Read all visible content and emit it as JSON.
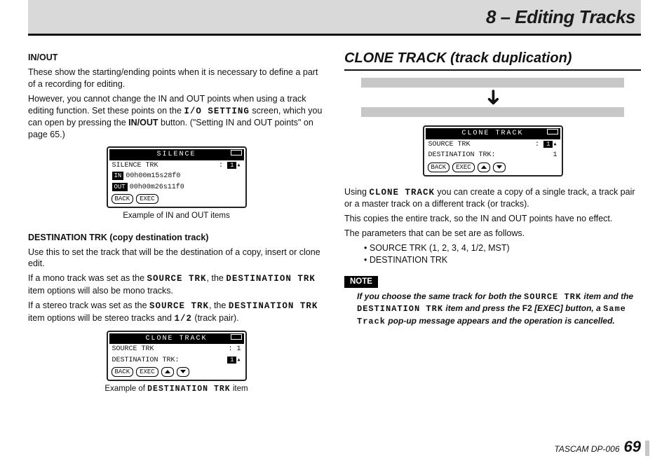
{
  "chapter": "8 – Editing Tracks",
  "left": {
    "inout_head": "IN/OUT",
    "inout_p1": "These show the starting/ending points when it is necessary to define a part of a recording for editing.",
    "inout_p2a": "However, you cannot change the IN and OUT points when using a track editing function. Set these points on the ",
    "inout_io": "I/O SETTING",
    "inout_p2b": " screen, which you can open by pressing the ",
    "inout_btn": "IN/OUT",
    "inout_p2c": " button. (\"Setting IN and OUT points\" on page 65.)",
    "fig1": {
      "title": "SILENCE",
      "row1_label": "SILENCE TRK",
      "row1_val": "1",
      "in_label": "IN",
      "in_val": "00h00m15s28f0",
      "out_label": "OUT",
      "out_val": "00h00m26s11f0",
      "back": "BACK",
      "exec": "EXEC"
    },
    "fig1_caption": "Example of IN and OUT items",
    "dest_head": "DESTINATION TRK (copy destination track)",
    "dest_p1": "Use this to set the track that will be the destination of a copy, insert or clone edit.",
    "dest_p2a": "If a mono track was set as the ",
    "src_trk": "SOURCE TRK",
    "dest_p2b": ", the ",
    "dest_trk": "DESTINATION TRK",
    "dest_p2c": " item options will also be mono tracks.",
    "dest_p3a": "If a stereo track was set as the ",
    "dest_p3b": ", the ",
    "dest_p3c": " item options will be stereo tracks and ",
    "onetwo": "1/2",
    "dest_p3d": " (track pair).",
    "fig2": {
      "title": "CLONE TRACK",
      "row1_label": "SOURCE TRK",
      "row1_val": "1",
      "row2_label": "DESTINATION TRK:",
      "row2_val": "1",
      "back": "BACK",
      "exec": "EXEC"
    },
    "fig2_caption_a": "Example of ",
    "fig2_caption_b": "DESTINATION TRK",
    "fig2_caption_c": " item"
  },
  "right": {
    "section": "CLONE TRACK (track duplication)",
    "fig3": {
      "title": "CLONE TRACK",
      "row1_label": "SOURCE TRK",
      "row1_val": "1",
      "row2_label": "DESTINATION TRK:",
      "row2_val": "1",
      "back": "BACK",
      "exec": "EXEC"
    },
    "p1a": "Using ",
    "clone_track": "CLONE TRACK",
    "p1b": " you can create a copy of a single track, a track pair or a master track on a different track (or tracks).",
    "p2": "This copies the entire track, so the IN and OUT points have no effect.",
    "p3": "The parameters that can be set are as follows.",
    "param1": "SOURCE TRK (1, 2, 3, 4, 1/2, MST)",
    "param2": "DESTINATION TRK",
    "note_label": "NOTE",
    "note_a": "If you choose the same track for both the ",
    "note_src": "SOURCE TRK",
    "note_b": " item and the ",
    "note_dst": "DESTINATION TRK",
    "note_c": " item and press the ",
    "note_f2": "F2",
    "note_exec": " [EXEC] button, a ",
    "note_same": "Same Track",
    "note_d": " pop-up message appears and the operation is cancelled."
  },
  "footer_model": "TASCAM  DP-006",
  "footer_page": "69"
}
